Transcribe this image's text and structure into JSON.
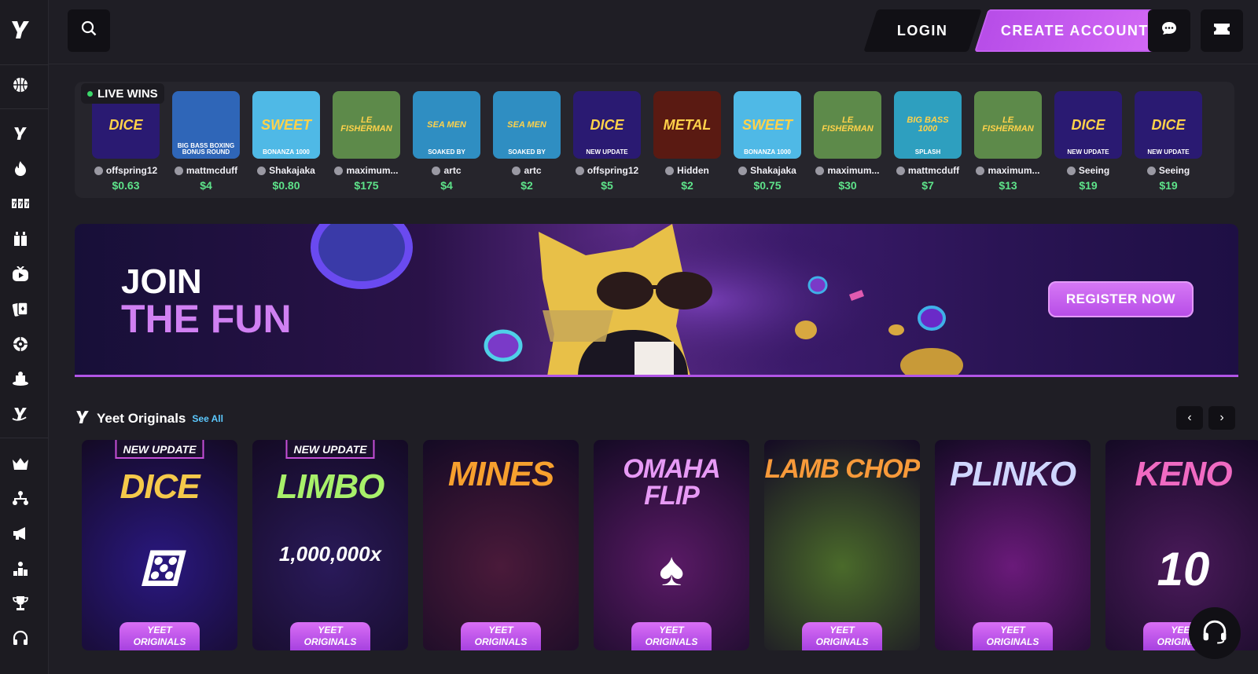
{
  "header": {
    "login_label": "LOGIN",
    "create_account_label": "CREATE ACCOUNT"
  },
  "live_wins": {
    "label": "LIVE WINS",
    "items": [
      {
        "game_text": "DICE",
        "game_sub": "",
        "user": "offspring12",
        "amount": "$0.63",
        "color": "#2a1a72"
      },
      {
        "game_text": "",
        "game_sub": "BIG BASS BOXING BONUS ROUND",
        "user": "mattmcduff",
        "amount": "$4",
        "color": "#2f66b8"
      },
      {
        "game_text": "SWEET",
        "game_sub": "BONANZA 1000",
        "user": "Shakajaka",
        "amount": "$0.80",
        "color": "#4fb9e6"
      },
      {
        "game_text": "LE FISHERMAN",
        "game_sub": "",
        "user": "maximum...",
        "amount": "$175",
        "color": "#5d8a4a"
      },
      {
        "game_text": "SEA MEN",
        "game_sub": "SOAKED BY",
        "user": "artc",
        "amount": "$4",
        "color": "#2f8ec2"
      },
      {
        "game_text": "SEA MEN",
        "game_sub": "SOAKED BY",
        "user": "artc",
        "amount": "$2",
        "color": "#2f8ec2"
      },
      {
        "game_text": "DICE",
        "game_sub": "NEW UPDATE",
        "user": "offspring12",
        "amount": "$5",
        "color": "#2a1a72"
      },
      {
        "game_text": "METAL",
        "game_sub": "",
        "user": "Hidden",
        "amount": "$2",
        "color": "#5a1a12"
      },
      {
        "game_text": "SWEET",
        "game_sub": "BONANZA 1000",
        "user": "Shakajaka",
        "amount": "$0.75",
        "color": "#4fb9e6"
      },
      {
        "game_text": "LE FISHERMAN",
        "game_sub": "",
        "user": "maximum...",
        "amount": "$30",
        "color": "#5d8a4a"
      },
      {
        "game_text": "BIG BASS 1000",
        "game_sub": "SPLASH",
        "user": "mattmcduff",
        "amount": "$7",
        "color": "#2e9fbf"
      },
      {
        "game_text": "LE FISHERMAN",
        "game_sub": "",
        "user": "maximum...",
        "amount": "$13",
        "color": "#5d8a4a"
      },
      {
        "game_text": "DICE",
        "game_sub": "NEW UPDATE",
        "user": "Seeing",
        "amount": "$19",
        "color": "#2a1a72"
      },
      {
        "game_text": "DICE",
        "game_sub": "NEW UPDATE",
        "user": "Seeing",
        "amount": "$19",
        "color": "#2a1a72"
      }
    ]
  },
  "banner": {
    "line1": "JOIN",
    "line2": "THE FUN",
    "cta": "REGISTER NOW"
  },
  "originals": {
    "title": "Yeet Originals",
    "see_all": "See All",
    "badge_line1": "YEET",
    "badge_line2": "ORIGINALS",
    "new_update": "NEW UPDATE",
    "cards": [
      {
        "name": "DICE",
        "new_update": true,
        "color": "#2a1880",
        "name_color": "#f5c94a",
        "art": "⚄"
      },
      {
        "name": "LIMBO",
        "new_update": true,
        "color": "#2a1a5a",
        "name_color": "#a8f06a",
        "art": "1,000,000x"
      },
      {
        "name": "MINES",
        "new_update": false,
        "color": "#4a1a3a",
        "name_color": "#f7a02e",
        "art": ""
      },
      {
        "name": "OMAHA FLIP",
        "new_update": false,
        "color": "#5a1a66",
        "name_color": "#e79af5",
        "art": "♠"
      },
      {
        "name": "LAMB CHOP",
        "new_update": false,
        "color": "#4a6a2a",
        "name_color": "#f79a3a",
        "art": ""
      },
      {
        "name": "PLINKO",
        "new_update": false,
        "color": "#6a1a7a",
        "name_color": "#cfd6ff",
        "art": ""
      },
      {
        "name": "KENO",
        "new_update": false,
        "color": "#4a1a5a",
        "name_color": "#f06ac2",
        "art": "10"
      }
    ]
  },
  "icons": {
    "sidebar": [
      "logo-icon",
      "basketball-icon",
      "yeet-icon",
      "flame-icon",
      "slots-icon",
      "live-casino-icon",
      "tv-icon",
      "cards-icon",
      "roulette-icon",
      "game-show-icon",
      "yeet-hand-icon",
      "crown-icon",
      "affiliate-icon",
      "megaphone-icon",
      "ranks-icon",
      "trophy-icon",
      "headphones-icon"
    ]
  }
}
